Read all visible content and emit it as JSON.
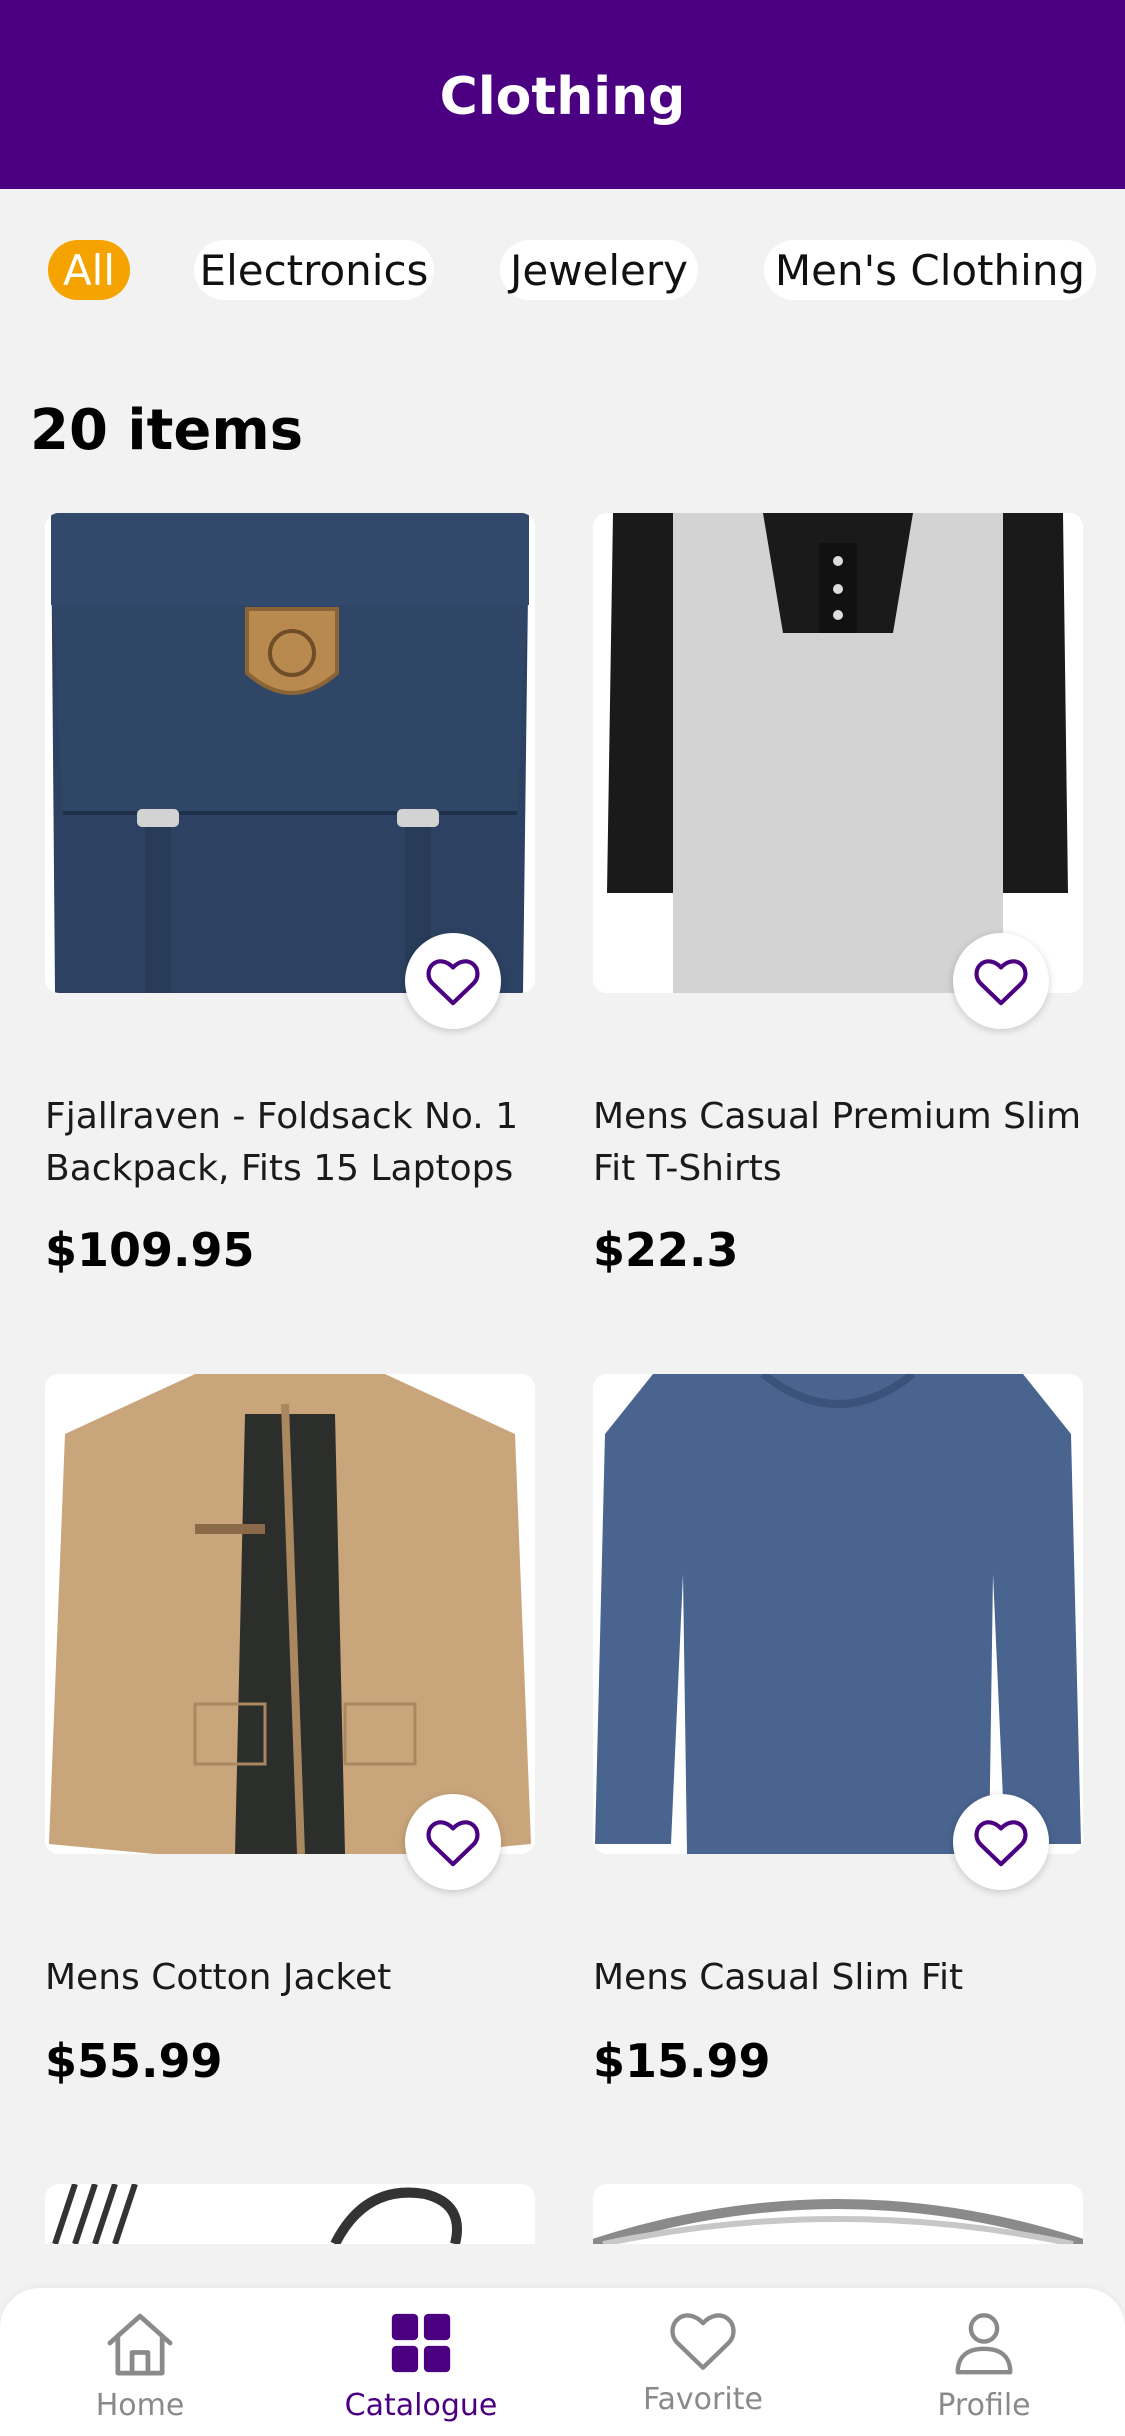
{
  "header": {
    "title": "Clothing"
  },
  "categories": [
    "All",
    "Electronics",
    "Jewelery",
    "Men's Clothing"
  ],
  "items_count": "20 items",
  "products": [
    {
      "title": "Fjallraven - Foldsack No. 1 Backpack, Fits 15 Laptops",
      "price": "$109.95",
      "image": "navy-backpack"
    },
    {
      "title": "Mens Casual Premium Slim Fit T-Shirts",
      "price": "$22.3",
      "image": "raglan-henley-shirt"
    },
    {
      "title": "Mens Cotton Jacket",
      "price": "$55.99",
      "image": "khaki-jacket"
    },
    {
      "title": "Mens Casual Slim Fit",
      "price": "$15.99",
      "image": "blue-long-sleeve-shirt"
    }
  ],
  "tabs": [
    {
      "label": "Home",
      "icon": "home-icon"
    },
    {
      "label": "Catalogue",
      "icon": "grid-icon"
    },
    {
      "label": "Favorite",
      "icon": "heart-icon"
    },
    {
      "label": "Profile",
      "icon": "person-icon"
    }
  ],
  "colors": {
    "brand": "#4b0082",
    "accent": "#f5a300",
    "background": "#f2f2f2"
  }
}
